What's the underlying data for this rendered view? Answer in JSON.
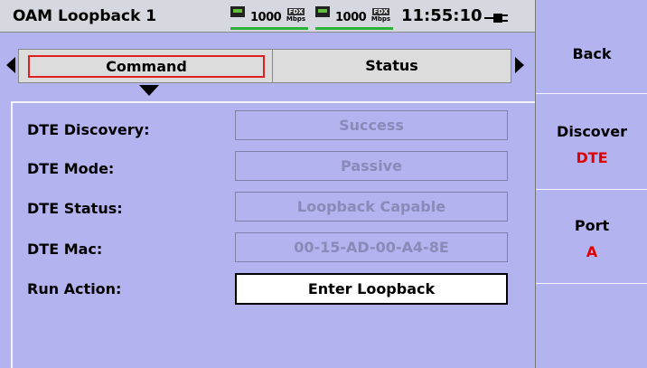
{
  "header": {
    "title": "OAM Loopback 1",
    "ports": [
      {
        "speed": "1000",
        "duplex": "FDX",
        "unit": "Mbps",
        "link_color": "#2bb03a"
      },
      {
        "speed": "1000",
        "duplex": "FDX",
        "unit": "Mbps",
        "link_color": "#2bb03a"
      }
    ],
    "clock": "11:55:10",
    "power_icon": "ac-plug-icon"
  },
  "tabs": [
    {
      "label": "Command",
      "selected": true
    },
    {
      "label": "Status",
      "selected": false
    }
  ],
  "form": {
    "rows": [
      {
        "label": "DTE Discovery:",
        "value": "Success"
      },
      {
        "label": "DTE Mode:",
        "value": "Passive"
      },
      {
        "label": "DTE Status:",
        "value": "Loopback Capable"
      },
      {
        "label": "DTE Mac:",
        "value": "00-15-AD-00-A4-8E"
      }
    ],
    "run_action": {
      "label": "Run Action:",
      "value": "Enter Loopback"
    }
  },
  "softkeys": {
    "back": {
      "label": "Back"
    },
    "discover": {
      "label": "Discover",
      "value": "DTE"
    },
    "port": {
      "label": "Port",
      "value": "A"
    }
  },
  "colors": {
    "background": "#b3b3f0",
    "header": "#d5d8de",
    "selected_tab_border": "#e02020",
    "softkey_value": "#e00000",
    "disabled_text": "#8a8ab8"
  }
}
